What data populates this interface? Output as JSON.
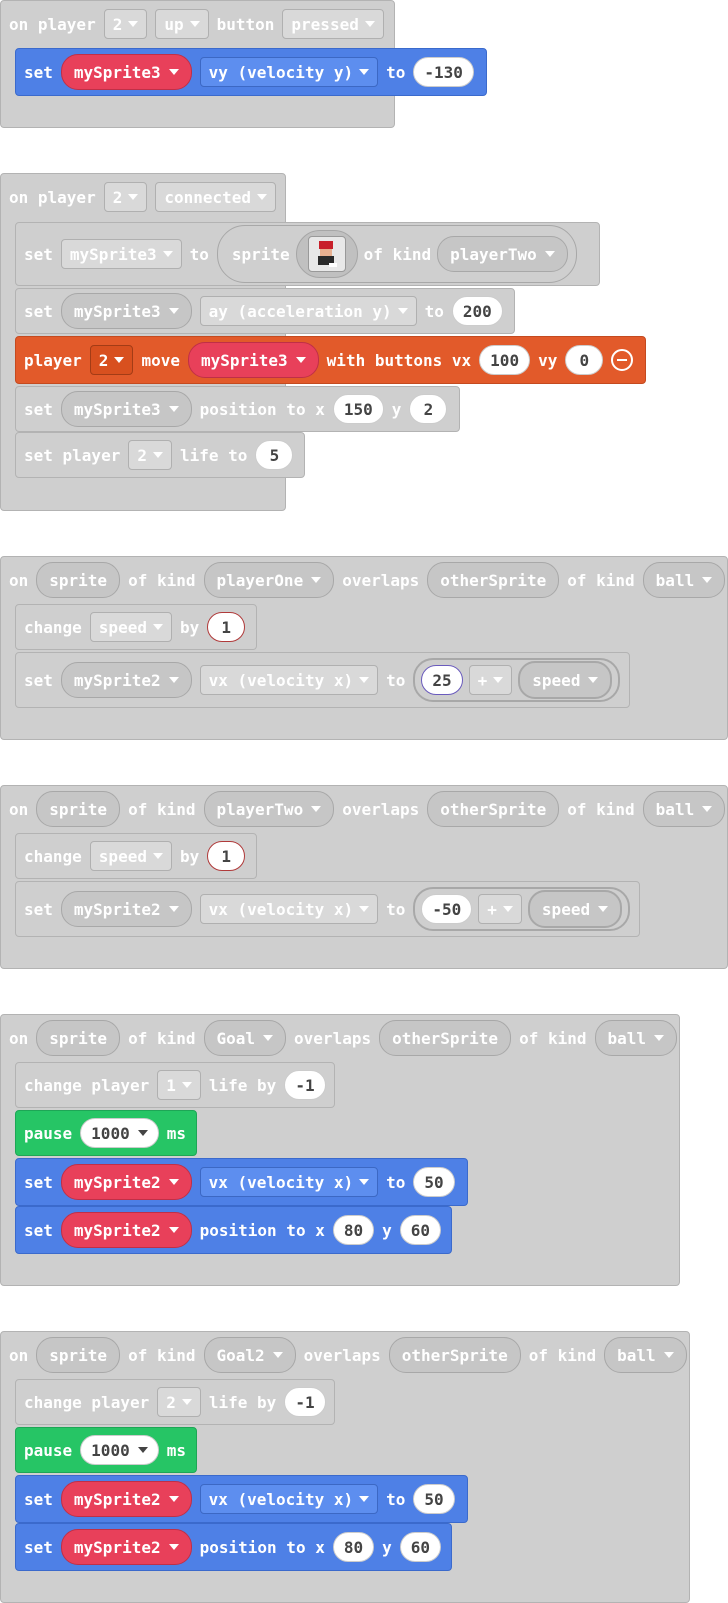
{
  "colors": {
    "blue": "#4e80e6",
    "red": "#e25a2a",
    "green": "#26c565",
    "pink": "#e8405a",
    "gray": "#cfcfcf"
  },
  "ev1": {
    "on": "on player",
    "player": "2",
    "button": "up",
    "button_kw": "button",
    "state": "pressed",
    "b1": {
      "set": "set",
      "sprite": "mySprite3",
      "prop": "vy (velocity y)",
      "to": "to",
      "value": "-130"
    }
  },
  "ev2": {
    "on": "on player",
    "player": "2",
    "state": "connected",
    "b1": {
      "set": "set",
      "var": "mySprite3",
      "to": "to",
      "sprite": "sprite",
      "of_kind": "of kind",
      "kind": "playerTwo"
    },
    "b2": {
      "set": "set",
      "sprite": "mySprite3",
      "prop": "ay (acceleration y)",
      "to": "to",
      "value": "200"
    },
    "b3": {
      "player": "player",
      "num": "2",
      "move": "move",
      "sprite": "mySprite3",
      "with": "with buttons vx",
      "vx": "100",
      "vy_kw": "vy",
      "vy": "0"
    },
    "b4": {
      "set": "set",
      "sprite": "mySprite3",
      "pos": "position to x",
      "x": "150",
      "y_kw": "y",
      "y": "2"
    },
    "b5": {
      "set": "set player",
      "num": "2",
      "life": "life to",
      "value": "5"
    }
  },
  "ev3": {
    "on": "on",
    "sprite": "sprite",
    "of_kind": "of kind",
    "kind": "playerOne",
    "overlaps": "overlaps",
    "other": "otherSprite",
    "of_kind2": "of kind",
    "kind2": "ball",
    "b1": {
      "change": "change",
      "var": "speed",
      "by": "by",
      "value": "1"
    },
    "b2": {
      "set": "set",
      "sprite": "mySprite2",
      "prop": "vx (velocity x)",
      "to": "to",
      "a": "25",
      "op": "+",
      "b": "speed"
    }
  },
  "ev4": {
    "on": "on",
    "sprite": "sprite",
    "of_kind": "of kind",
    "kind": "playerTwo",
    "overlaps": "overlaps",
    "other": "otherSprite",
    "of_kind2": "of kind",
    "kind2": "ball",
    "b1": {
      "change": "change",
      "var": "speed",
      "by": "by",
      "value": "1"
    },
    "b2": {
      "set": "set",
      "sprite": "mySprite2",
      "prop": "vx (velocity x)",
      "to": "to",
      "a": "-50",
      "op": "+",
      "b": "speed"
    }
  },
  "ev5": {
    "on": "on",
    "sprite": "sprite",
    "of_kind": "of kind",
    "kind": "Goal",
    "overlaps": "overlaps",
    "other": "otherSprite",
    "of_kind2": "of kind",
    "kind2": "ball",
    "b1": {
      "change": "change player",
      "num": "1",
      "life": "life by",
      "value": "-1"
    },
    "b2": {
      "pause": "pause",
      "ms_val": "1000",
      "ms": "ms"
    },
    "b3": {
      "set": "set",
      "sprite": "mySprite2",
      "prop": "vx (velocity x)",
      "to": "to",
      "value": "50"
    },
    "b4": {
      "set": "set",
      "sprite": "mySprite2",
      "pos": "position to x",
      "x": "80",
      "y_kw": "y",
      "y": "60"
    }
  },
  "ev6": {
    "on": "on",
    "sprite": "sprite",
    "of_kind": "of kind",
    "kind": "Goal2",
    "overlaps": "overlaps",
    "other": "otherSprite",
    "of_kind2": "of kind",
    "kind2": "ball",
    "b1": {
      "change": "change player",
      "num": "2",
      "life": "life by",
      "value": "-1"
    },
    "b2": {
      "pause": "pause",
      "ms_val": "1000",
      "ms": "ms"
    },
    "b3": {
      "set": "set",
      "sprite": "mySprite2",
      "prop": "vx (velocity x)",
      "to": "to",
      "value": "50"
    },
    "b4": {
      "set": "set",
      "sprite": "mySprite2",
      "pos": "position to x",
      "x": "80",
      "y_kw": "y",
      "y": "60"
    }
  }
}
